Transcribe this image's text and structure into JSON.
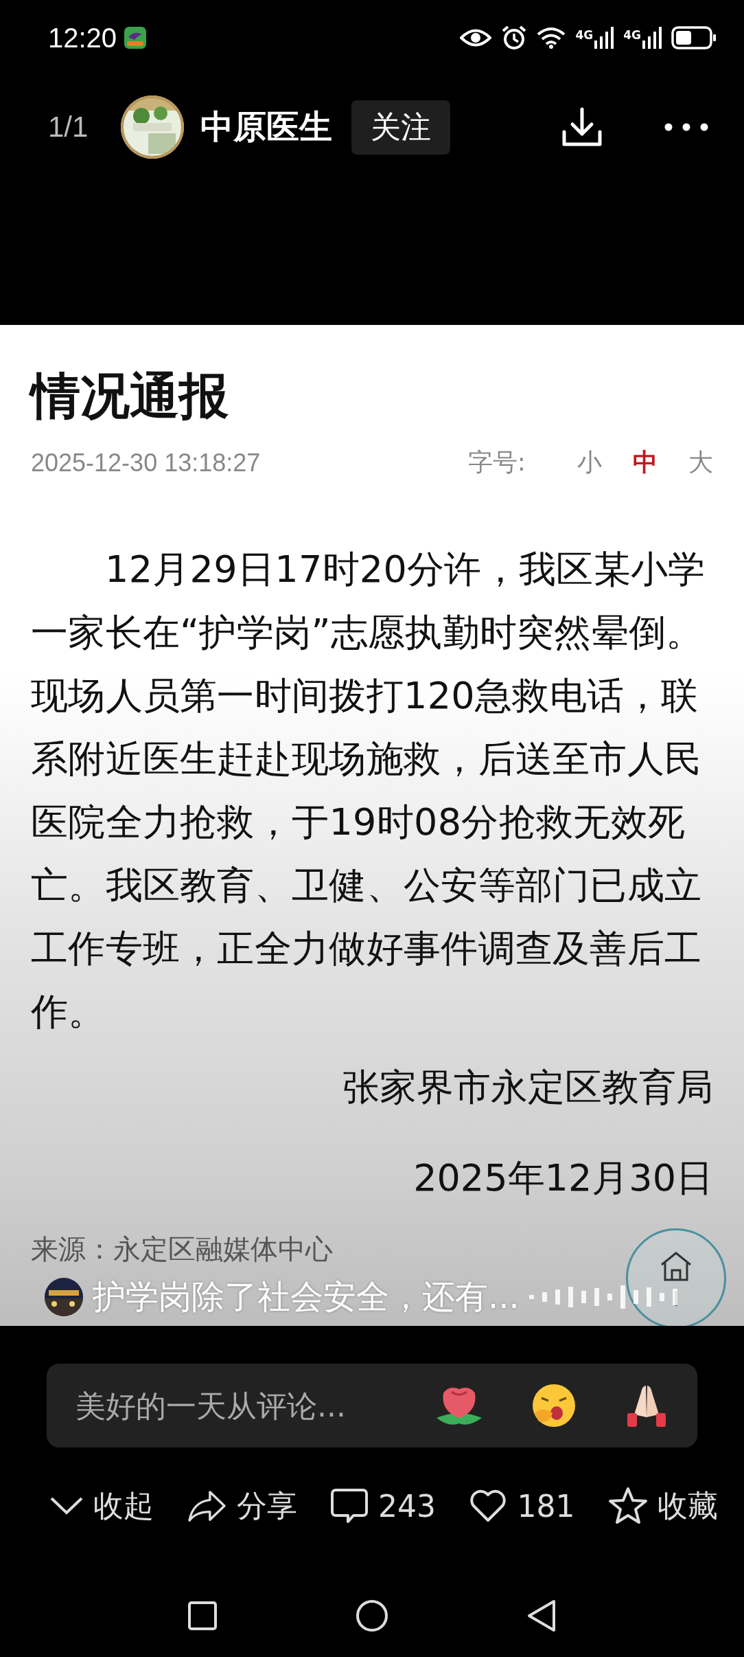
{
  "status_bar": {
    "time": "12:20",
    "networks": [
      {
        "label": "4G"
      },
      {
        "label": "4G"
      }
    ]
  },
  "header": {
    "page_counter": "1/1",
    "account_name": "中原医生",
    "follow_button": "关注"
  },
  "article": {
    "title": "情况通报",
    "date": "2025-12-30 13:18:27",
    "font_size_label": "字号:",
    "font_sizes": [
      {
        "label": "小",
        "selected": false
      },
      {
        "label": "中",
        "selected": true
      },
      {
        "label": "大",
        "selected": false
      }
    ],
    "body": "12月29日17时20分许，我区某小学一家长在“护学岗”志愿执勤时突然晕倒。现场人员第一时间拨打120急救电话，联系附近医生赶赴现场施救，后送至市人民医院全力抢救，于19时08分抢救无效死亡。我区教育、卫健、公安等部门已成立工作专班，正全力做好事件调查及善后工作。",
    "signature": "张家界市永定区教育局",
    "signature_date": "2025年12月30日",
    "source": "来源：永定区融媒体中心"
  },
  "caption": "护学岗除了社会安全，还有...",
  "comment_box": {
    "placeholder": "美好的一天从评论..."
  },
  "actions": [
    {
      "kind": "collapse",
      "label": "收起"
    },
    {
      "kind": "share",
      "label": "分享"
    },
    {
      "kind": "comment",
      "label": "243"
    },
    {
      "kind": "like",
      "label": "181"
    },
    {
      "kind": "favorite",
      "label": "收藏"
    }
  ]
}
